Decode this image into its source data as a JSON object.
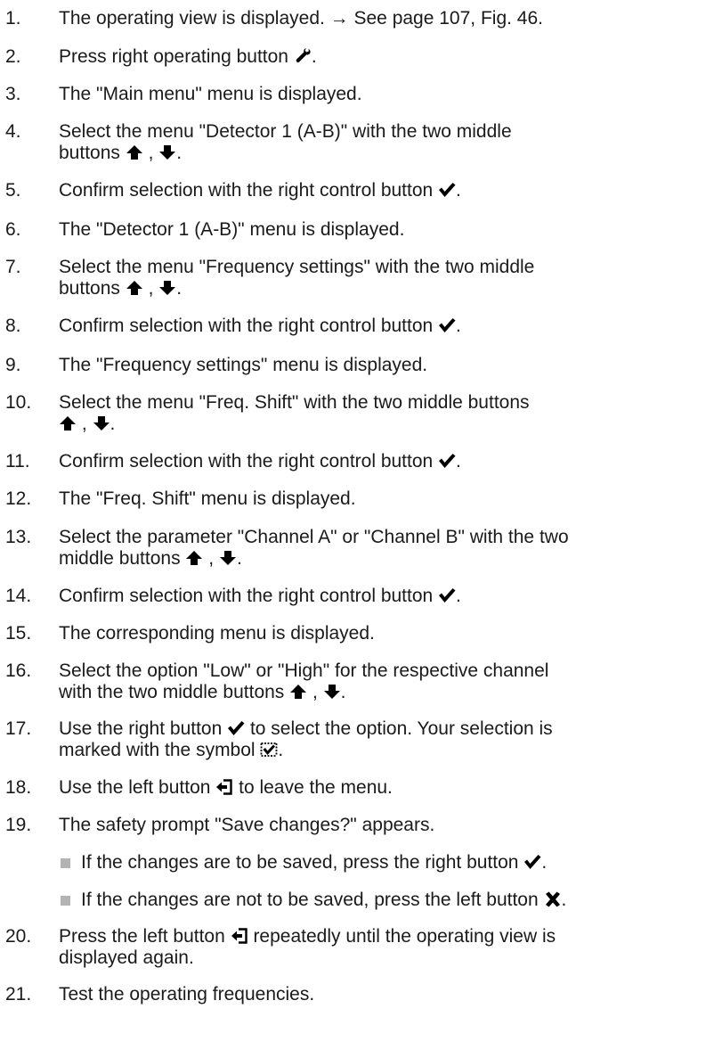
{
  "steps": [
    {
      "num": "1.",
      "parts": [
        "The operating view is displayed. → See page 107, Fig. 46."
      ]
    },
    {
      "num": "2.",
      "parts": [
        "Press right operating button ",
        {
          "icon": "wrench-icon"
        },
        "."
      ]
    },
    {
      "num": "3.",
      "parts": [
        "The \"Main menu\" menu is displayed."
      ]
    },
    {
      "num": "4.",
      "parts": [
        "Select the menu \"Detector 1 (A-B)\" with the two middle",
        {
          "br": true
        },
        "buttons ",
        {
          "icon": "arrow-up-icon"
        },
        " , ",
        {
          "icon": "arrow-down-icon"
        },
        "."
      ]
    },
    {
      "num": "5.",
      "parts": [
        "Confirm selection with the right control button ",
        {
          "icon": "checkmark-icon"
        },
        "."
      ]
    },
    {
      "num": "6.",
      "parts": [
        "The \"Detector 1 (A-B)\" menu is displayed."
      ]
    },
    {
      "num": "7.",
      "parts": [
        "Select the menu \"Frequency settings\" with the two middle",
        {
          "br": true
        },
        "buttons ",
        {
          "icon": "arrow-up-icon"
        },
        " , ",
        {
          "icon": "arrow-down-icon"
        },
        "."
      ]
    },
    {
      "num": "8.",
      "parts": [
        "Confirm selection with the right control button ",
        {
          "icon": "checkmark-icon"
        },
        "."
      ]
    },
    {
      "num": "9.",
      "parts": [
        "The \"Frequency settings\" menu is displayed."
      ]
    },
    {
      "num": "10.",
      "parts": [
        "Select the menu \"Freq. Shift\" with the two middle buttons",
        {
          "br": true
        },
        {
          "icon": "arrow-up-icon"
        },
        " , ",
        {
          "icon": "arrow-down-icon"
        },
        "."
      ]
    },
    {
      "num": "11.",
      "parts": [
        "Confirm selection with the right control button ",
        {
          "icon": "checkmark-icon"
        },
        "."
      ]
    },
    {
      "num": "12.",
      "parts": [
        "The \"Freq. Shift\" menu is displayed."
      ]
    },
    {
      "num": "13.",
      "parts": [
        "Select the parameter \"Channel A\" or \"Channel B\" with the two",
        {
          "br": true
        },
        "middle buttons ",
        {
          "icon": "arrow-up-icon"
        },
        " , ",
        {
          "icon": "arrow-down-icon"
        },
        "."
      ]
    },
    {
      "num": "14.",
      "parts": [
        "Confirm selection with the right control button ",
        {
          "icon": "checkmark-icon"
        },
        "."
      ]
    },
    {
      "num": "15.",
      "parts": [
        "The corresponding menu is displayed."
      ]
    },
    {
      "num": "16.",
      "parts": [
        "Select the option \"Low\" or \"High\" for the respective channel",
        {
          "br": true
        },
        "with the two middle buttons ",
        {
          "icon": "arrow-up-icon"
        },
        " , ",
        {
          "icon": "arrow-down-icon"
        },
        "."
      ]
    },
    {
      "num": "17.",
      "parts": [
        "Use the right button ",
        {
          "icon": "checkmark-icon"
        },
        " to select the option. Your selection is",
        {
          "br": true
        },
        "marked with the symbol ",
        {
          "icon": "checked-box-icon"
        },
        "."
      ]
    },
    {
      "num": "18.",
      "parts": [
        "Use the left button ",
        {
          "icon": "exit-icon"
        },
        " to leave the menu."
      ]
    },
    {
      "num": "19.",
      "parts": [
        "The safety prompt \"Save changes?\" appears."
      ]
    },
    {
      "num": "20.",
      "parts": [
        "Press the left button ",
        {
          "icon": "exit-icon"
        },
        " repeatedly until the operating view is",
        {
          "br": true
        },
        "displayed again."
      ]
    },
    {
      "num": "21.",
      "parts": [
        "Test the operating frequencies."
      ]
    }
  ],
  "sub_items": [
    {
      "parts": [
        "If the changes are to be saved, press the right button ",
        {
          "icon": "checkmark-icon"
        },
        "."
      ]
    },
    {
      "parts": [
        "If the changes are not to be saved, press the left button ",
        {
          "icon": "cross-icon"
        },
        "."
      ]
    }
  ]
}
